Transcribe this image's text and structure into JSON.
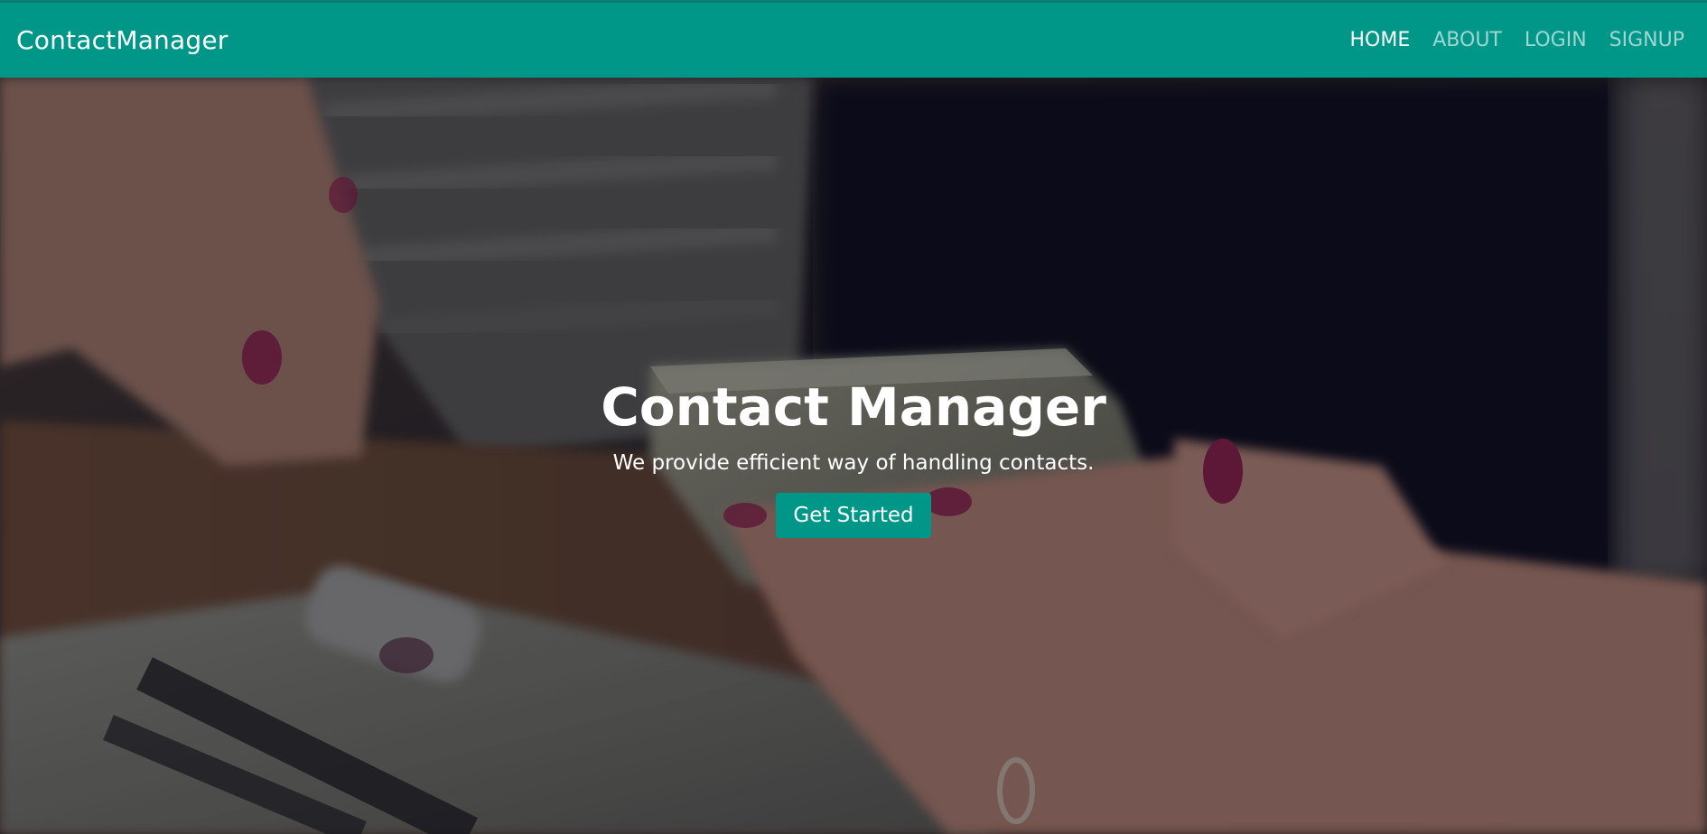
{
  "navbar": {
    "brand": "ContactManager",
    "links": [
      {
        "label": "HOME",
        "active": true
      },
      {
        "label": "ABOUT",
        "active": false
      },
      {
        "label": "LOGIN",
        "active": false
      },
      {
        "label": "SIGNUP",
        "active": false
      }
    ]
  },
  "hero": {
    "title": "Contact Manager",
    "subtitle": "We provide efficient way of handling contacts.",
    "cta_label": "Get Started"
  },
  "colors": {
    "primary": "#009688",
    "nav_text": "#ffffff",
    "nav_text_inactive": "rgba(255,255,255,0.62)"
  }
}
